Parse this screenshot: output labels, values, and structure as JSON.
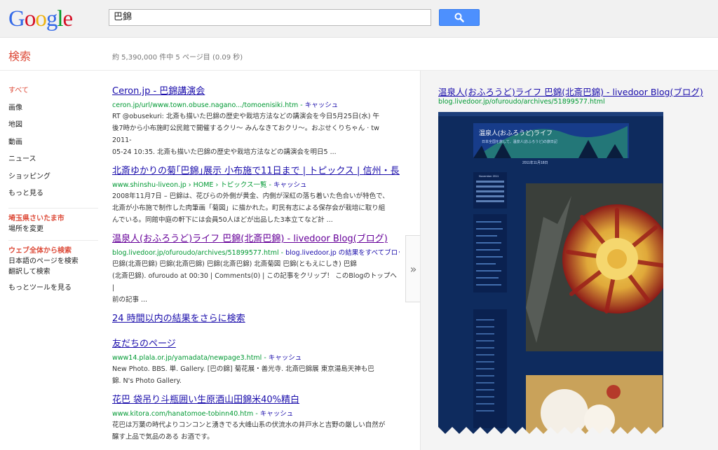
{
  "header": {
    "logo_letters": [
      {
        "char": "G",
        "color": "#3369e8"
      },
      {
        "char": "o",
        "color": "#d50f25"
      },
      {
        "char": "o",
        "color": "#eeb211"
      },
      {
        "char": "g",
        "color": "#3369e8"
      },
      {
        "char": "l",
        "color": "#009925"
      },
      {
        "char": "e",
        "color": "#d50f25"
      }
    ],
    "query": "巴錦",
    "search_icon": "magnifier-icon"
  },
  "subheader": {
    "label": "検索",
    "stats": "約 5,390,000 件中 5 ページ目 (0.09 秒)"
  },
  "nav": {
    "types": [
      "すべて",
      "画像",
      "地図",
      "動画",
      "ニュース",
      "ショッピング",
      "もっと見る"
    ],
    "location": "埼玉県さいたま市",
    "location_change": "場所を変更",
    "scope_head": "ウェブ全体から検索",
    "scope_items": [
      "日本語のページを検索",
      "翻訳して検索"
    ],
    "more_tools": "もっとツールを見る"
  },
  "results": [
    {
      "title": "Ceron.jp - 巴錦講演会",
      "url": "ceron.jp/url/www.town.obuse.nagano.../tomoenisiki.htm",
      "cache": "キャッシュ",
      "snippet": [
        "RT @obusekuri: 北斎も描いた巴錦の歴史や栽培方法などの講演会を今日5月25日(水) 午",
        "後7時から小布施町公民館で開催するクリ〜 みんなきておクリ〜。おぶせくりちゃん · tw 2011-",
        "05-24 10:35. 北斎も描いた巴錦の歴史や栽培方法などの講演会を明日5 ..."
      ]
    },
    {
      "title": "北斎ゆかりの菊｢巴錦｣展示 小布施で11日まで | トピックス | 信州・長野県 ...",
      "url": "www.shinshu-liveon.jp › HOME › トピックス一覧",
      "cache": "キャッシュ",
      "snippet": [
        "2008年11月7日 – 巴錦は、花びらの外側が黄金、内側が深紅の落ち着いた色合いが特色で、",
        "北斎が小布施で制作した肉筆画「菊図」に描かれた。町民有志による保存会が栽培に取り組",
        "んでいる。同館中庭の軒下には会員50人ほどが出品した3本立てなど計 ..."
      ]
    },
    {
      "title": "温泉人(おふろうど)ライフ 巴錦(北斎巴錦) - livedoor Blog(ブログ)",
      "url": "blog.livedoor.jp/ofuroudo/archives/51899577.html",
      "cache": "blog.livedoor.jp の結果をすべてブロック",
      "snippet": [
        "巴錦(北斎巴錦) 巴錦(北斎巴錦) 巴錦(北斎巴錦) 北斎菊図 巴錦(ともえにしき) 巴錦",
        "(北斎巴錦). ofuroudo at 00:30 | Comments(0) | この記事をクリップ！ このBlogのトップへ |",
        "前の記事 ..."
      ]
    },
    {
      "title": "友だちのページ",
      "url": "www14.plala.or.jp/yamadata/newpage3.html",
      "cache": "キャッシュ",
      "snippet": [
        "New Photo. BBS. 単. Gallery. [巴の錦] 菊花展・善光寺. 北斎巴錦展 東京湯島天神も巴",
        "錦. N's Photo Gallery."
      ]
    },
    {
      "title": "花巴 袋吊り斗瓶囲い生原酒山田錦米40%精白",
      "url": "www.kitora.com/hanatomoe-tobinn40.htm",
      "cache": "キャッシュ",
      "snippet": [
        "花巴は万葉の時代よりコンコンと湧きでる大峰山系の伏流水の井戸水と吉野の厳しい自然が",
        "醸す上品で気品のある お酒です。"
      ]
    }
  ],
  "more_results": "24 時間以内の結果をさらに検索",
  "preview": {
    "toggle": "»",
    "title": "温泉人(おふろうど)ライフ 巴錦(北斎巴錦) - livedoor Blog(ブログ)",
    "url": "blog.livedoor.jp/ofuroudo/archives/51899577.html",
    "blog_title": "温泉人(おふろうど)ライフ",
    "blog_subtitle": "日本全国を旅して、温泉人(おふろうど)の旅日記",
    "calendar_title": "November 2011",
    "date": "2011年11月18日"
  }
}
